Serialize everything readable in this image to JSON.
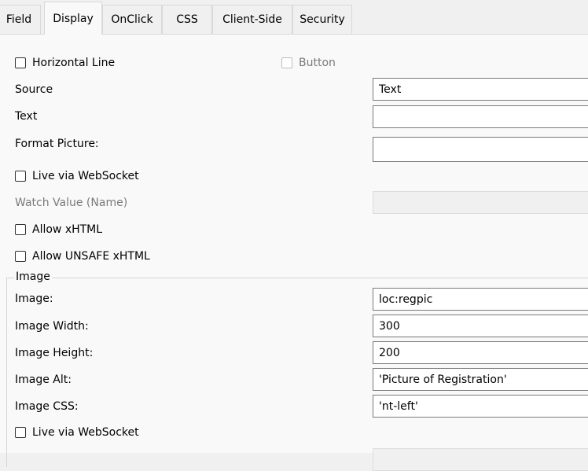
{
  "tabs": [
    {
      "label": "Field"
    },
    {
      "label": "Display"
    },
    {
      "label": "OnClick"
    },
    {
      "label": "CSS"
    },
    {
      "label": "Client-Side"
    },
    {
      "label": "Security"
    }
  ],
  "active_tab": "Display",
  "display": {
    "horizontal_line": {
      "label": "Horizontal Line",
      "checked": false
    },
    "button": {
      "label": "Button",
      "checked": false,
      "disabled": true
    },
    "source": {
      "label": "Source",
      "value": "Text"
    },
    "text": {
      "label": "Text",
      "value": ""
    },
    "format_picture": {
      "label": "Format Picture:",
      "value": ""
    },
    "live_websocket": {
      "label": "Live via WebSocket",
      "checked": false
    },
    "watch_value": {
      "label": "Watch Value (Name)",
      "value": ""
    },
    "allow_xhtml": {
      "label": "Allow xHTML",
      "checked": false
    },
    "allow_unsafe_xhtml": {
      "label": "Allow UNSAFE xHTML",
      "checked": false
    }
  },
  "image_group": {
    "title": "Image",
    "image": {
      "label": "Image:",
      "value": "loc:regpic"
    },
    "width": {
      "label": "Image Width:",
      "value": "300"
    },
    "height": {
      "label": "Image Height:",
      "value": "200"
    },
    "alt": {
      "label": "Image Alt:",
      "value": "'Picture of Registration'"
    },
    "css": {
      "label": "Image CSS:",
      "value": "'nt-left'"
    },
    "live_websocket": {
      "label": "Live via WebSocket",
      "checked": false
    },
    "watch_value": {
      "value": ""
    }
  }
}
